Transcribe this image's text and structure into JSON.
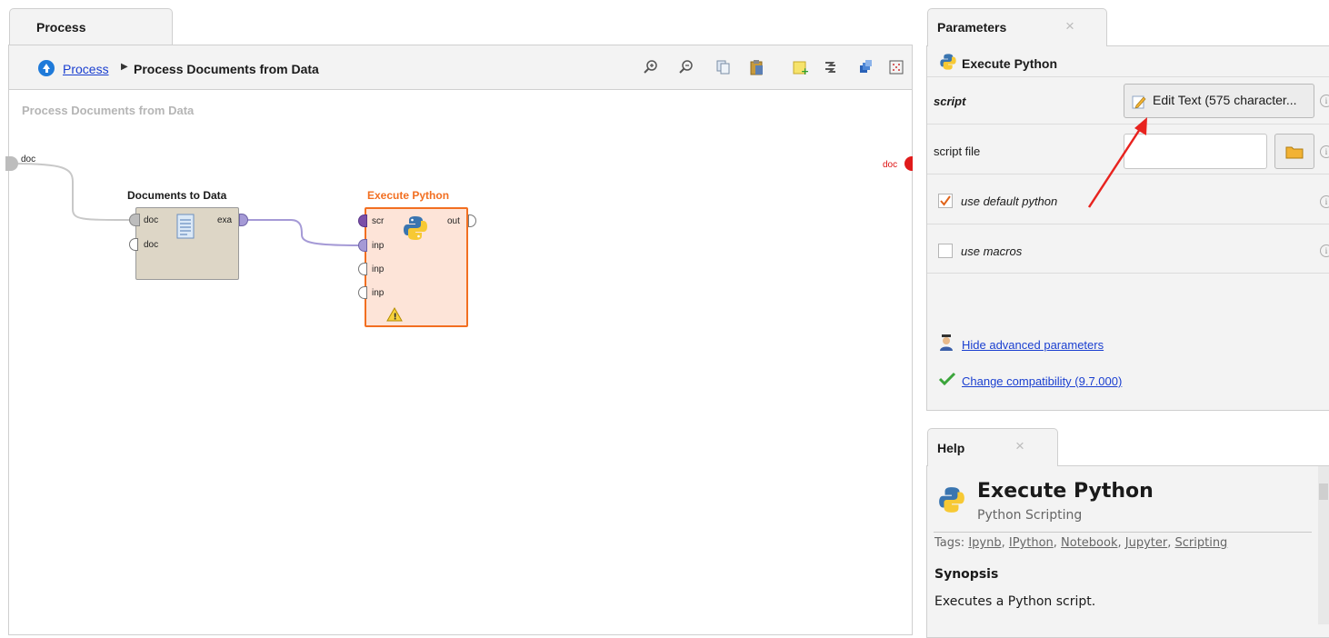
{
  "process_panel": {
    "tab_label": "Process",
    "breadcrumb": {
      "link": "Process",
      "separator": "▶",
      "current": "Process Documents from Data"
    },
    "canvas_title": "Process Documents from Data",
    "toolbar_icons": [
      "zoom-in-icon",
      "zoom-out-icon",
      "copy-icon",
      "paste-icon",
      "add-note-icon",
      "auto-wire-icon",
      "layers-icon",
      "grid-icon"
    ],
    "left_port_label": "doc",
    "right_port_label": "doc",
    "operators": {
      "documents_to_data": {
        "title": "Documents to Data",
        "in_ports": [
          "doc",
          "doc"
        ],
        "out_ports": [
          "exa"
        ]
      },
      "execute_python": {
        "title": "Execute Python",
        "in_ports": [
          "scr",
          "inp",
          "inp",
          "inp"
        ],
        "out_ports": [
          "out"
        ],
        "warning": "!"
      }
    }
  },
  "parameters_panel": {
    "tab_label": "Parameters",
    "close_glyph": "×",
    "operator_name": "Execute Python",
    "rows": {
      "script": {
        "label": "script",
        "button": "Edit Text (575 character..."
      },
      "script_file": {
        "label": "script file",
        "value": ""
      },
      "use_default_python": {
        "label": "use default python",
        "checked": true
      },
      "use_macros": {
        "label": "use macros",
        "checked": false
      }
    },
    "info_glyph": "i",
    "links": {
      "advanced": "Hide advanced parameters",
      "compatibility": "Change compatibility (9.7.000)"
    }
  },
  "help_panel": {
    "tab_label": "Help",
    "close_glyph": "×",
    "title": "Execute Python",
    "subtitle": "Python Scripting",
    "tags_prefix": "Tags:",
    "tags": [
      "Ipynb",
      "IPython",
      "Notebook",
      "Jupyter",
      "Scripting"
    ],
    "synopsis_heading": "Synopsis",
    "synopsis": "Executes a Python script."
  },
  "colors": {
    "accent_orange": "#f26f21",
    "link_blue": "#1a3fd0",
    "annotation_red": "#e8231f"
  }
}
